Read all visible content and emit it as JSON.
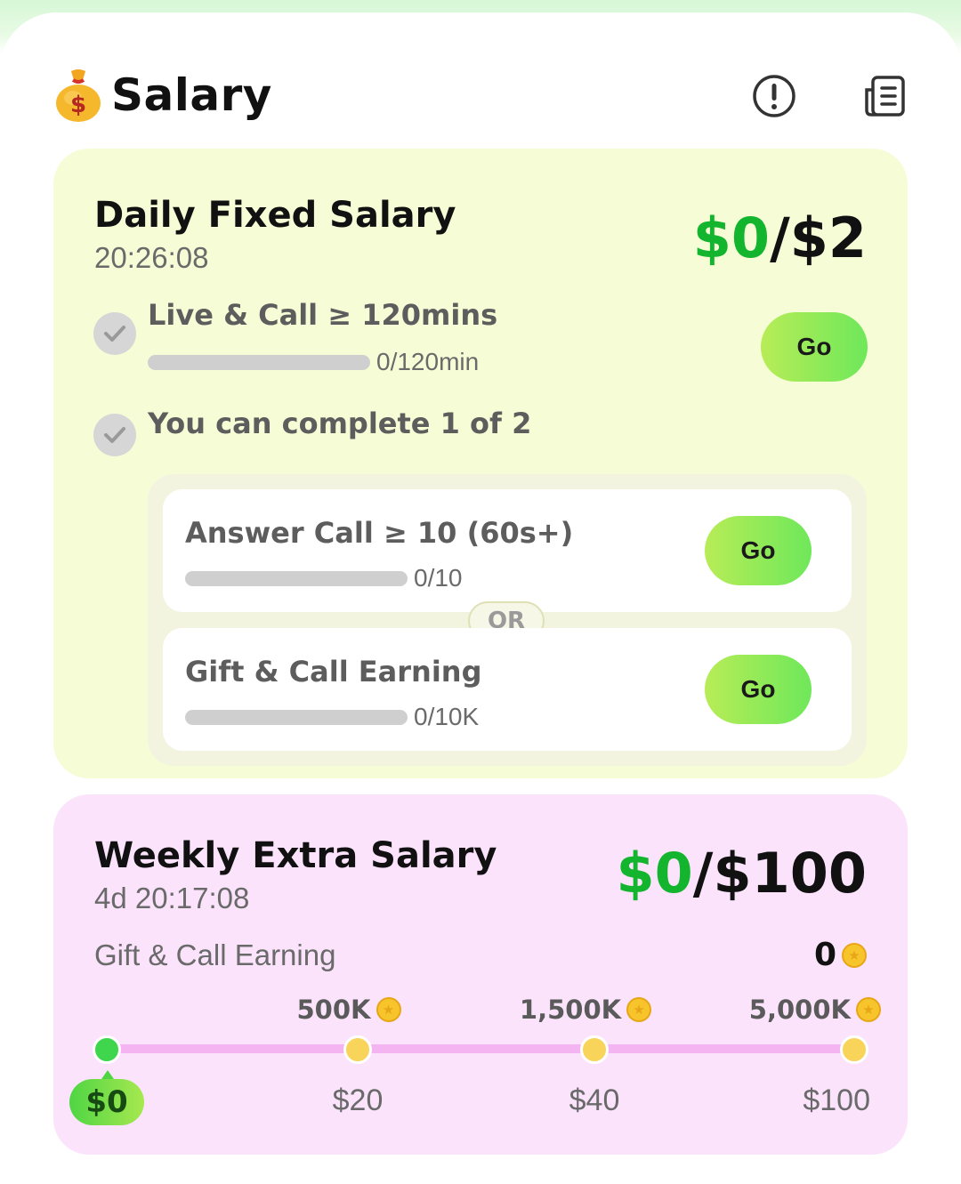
{
  "header": {
    "title": "Salary",
    "icons": {
      "logo": "money-bag-icon",
      "info": "info-icon",
      "records": "records-icon"
    }
  },
  "daily": {
    "title": "Daily Fixed Salary",
    "countdown": "20:26:08",
    "earned": "$0",
    "total": "$2",
    "task1": {
      "label": "Live & Call ≥ 120mins",
      "progress_text": "0/120min",
      "progress_fraction": 0,
      "button": "Go"
    },
    "task2_label": "You can complete 1 of 2",
    "option_a": {
      "label": "Answer Call ≥ 10 (60s+)",
      "progress_text": "0/10",
      "progress_fraction": 0,
      "button": "Go"
    },
    "or_label": "OR",
    "option_b": {
      "label": "Gift & Call Earning",
      "progress_text": "0/10K",
      "progress_fraction": 0,
      "button": "Go"
    }
  },
  "weekly": {
    "title": "Weekly Extra Salary",
    "countdown": "4d 20:17:08",
    "earned": "$0",
    "total": "$100",
    "earning_label": "Gift & Call Earning",
    "earning_value": "0",
    "milestones": [
      {
        "threshold": "",
        "reward": "$0",
        "reached": true
      },
      {
        "threshold": "500K",
        "reward": "$20",
        "reached": false
      },
      {
        "threshold": "1,500K",
        "reward": "$40",
        "reached": false
      },
      {
        "threshold": "5,000K",
        "reward": "$100",
        "reached": false
      }
    ]
  },
  "colors": {
    "earned": "#14b52e",
    "daily_bg": "#f6fdd6",
    "weekly_bg": "#fbe4fb",
    "go_button": "#8ae85a"
  }
}
